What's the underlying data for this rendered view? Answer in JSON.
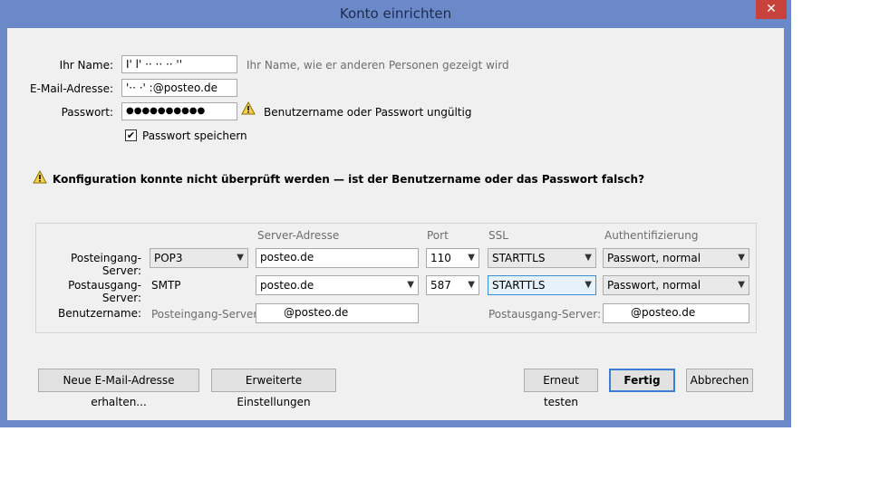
{
  "window": {
    "title": "Konto einrichten",
    "close_glyph": "✕"
  },
  "form": {
    "name_label": "Ihr Name:",
    "name_value": "I' l' ·· ·· ·· ''",
    "name_hint": "Ihr Name, wie er anderen Personen gezeigt wird",
    "email_label": "E-Mail-Adresse:",
    "email_value": "'·· ·' :@posteo.de",
    "password_label": "Passwort:",
    "password_value": "●●●●●●●●●●",
    "password_hint": "Benutzername oder Passwort ungültig",
    "remember_label": "Passwort speichern",
    "remember_checked": true
  },
  "warning": {
    "message": "Konfiguration konnte nicht überprüft werden — ist der Benutzername oder das Passwort falsch?"
  },
  "server": {
    "headers": {
      "address": "Server-Adresse",
      "port": "Port",
      "ssl": "SSL",
      "auth": "Authentifizierung"
    },
    "incoming": {
      "label": "Posteingang-Server:",
      "protocol": "POP3",
      "address": "posteo.de",
      "port": "110",
      "ssl": "STARTTLS",
      "auth": "Passwort, normal"
    },
    "outgoing": {
      "label": "Postausgang-Server:",
      "protocol": "SMTP",
      "address": "posteo.de",
      "port": "587",
      "ssl": "STARTTLS",
      "auth": "Passwort, normal"
    },
    "username": {
      "label": "Benutzername:",
      "incoming_label": "Posteingang-Server:",
      "incoming_value": "@posteo.de",
      "outgoing_label": "Postausgang-Server:",
      "outgoing_value": "@posteo.de"
    }
  },
  "buttons": {
    "new_address": "Neue E-Mail-Adresse erhalten...",
    "advanced": "Erweiterte Einstellungen",
    "retest": "Erneut testen",
    "done": "Fertig",
    "cancel": "Abbrechen"
  },
  "colors": {
    "titlebar": "#6b88c9",
    "close": "#c7423a",
    "dialog_bg": "#f0f0f0",
    "focus": "#3c7fd1"
  }
}
